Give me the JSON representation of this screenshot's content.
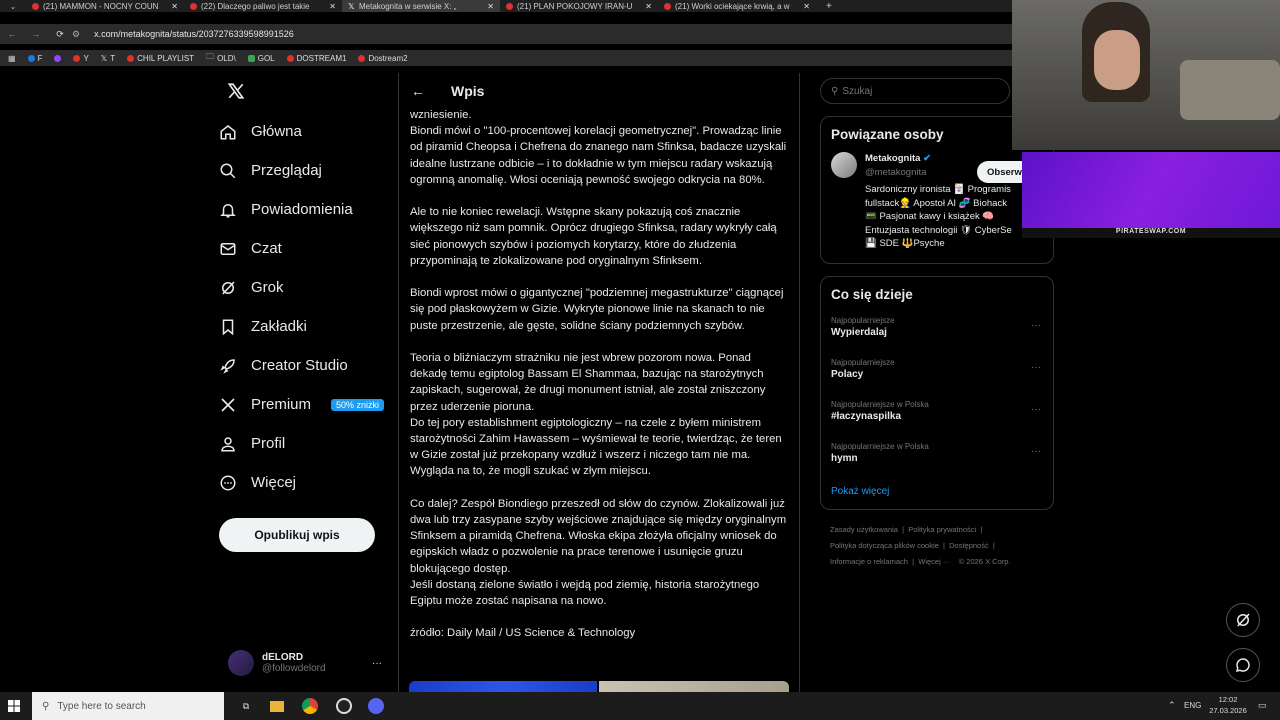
{
  "browser": {
    "tabs": [
      {
        "label": "(21) MAMMON - NOCNY COUN",
        "active": false
      },
      {
        "label": "(22) Dlaczego paliwo jest takie",
        "active": false
      },
      {
        "label": "Metakognita w serwisie X: „",
        "active": true
      },
      {
        "label": "(21) PLAN POKOJOWY IRAN-U",
        "active": false
      },
      {
        "label": "(21) Worki ociekające krwią, a w",
        "active": false
      }
    ],
    "new_tab": "+",
    "url": "x.com/metakognita/status/2037276339598991526",
    "bookmarks": [
      "F",
      "Y",
      "T",
      "CHIL PLAYLIST",
      "OLD\\",
      "GOL",
      "DOSTREAM1",
      "Dostream2"
    ]
  },
  "sidebar": {
    "items": [
      {
        "label": "Główna",
        "icon": "home-icon"
      },
      {
        "label": "Przeglądaj",
        "icon": "search-icon"
      },
      {
        "label": "Powiadomienia",
        "icon": "bell-icon"
      },
      {
        "label": "Czat",
        "icon": "mail-icon"
      },
      {
        "label": "Grok",
        "icon": "grok-icon"
      },
      {
        "label": "Zakładki",
        "icon": "bookmark-icon"
      },
      {
        "label": "Creator Studio",
        "icon": "rocket-icon"
      },
      {
        "label": "Premium",
        "icon": "x-logo-icon"
      },
      {
        "label": "Profil",
        "icon": "person-icon"
      },
      {
        "label": "Więcej",
        "icon": "more-circle-icon"
      }
    ],
    "premium_badge": "50% zniżki",
    "publish_label": "Opublikuj wpis",
    "account": {
      "name": "dELORD",
      "handle": "@followdelord",
      "menu": "···"
    }
  },
  "main": {
    "header": "Wpis",
    "post_paragraphs": [
      "wzniesienie.",
      "Biondi mówi o \"100-procentowej korelacji geometrycznej\". Prowadząc linie od piramid Cheopsa i Chefrena do znanego nam Sfinksa, badacze uzyskali idealne lustrzane odbicie – i to dokładnie w tym miejscu radary wskazują ogromną anomalię. Włosi oceniają pewność swojego odkrycia na 80%.",
      "Ale to nie koniec rewelacji. Wstępne skany pokazują coś znacznie większego niż sam pomnik. Oprócz drugiego Sfinksa, radary wykryły całą sieć pionowych szybów i poziomych korytarzy, które do złudzenia przypominają te zlokalizowane pod oryginalnym Sfinksem.",
      "Biondi wprost mówi o gigantycznej \"podziemnej megastrukturze\" ciągnącej się pod płaskowyżem w Gizie. Wykryte pionowe linie na skanach to nie puste przestrzenie, ale gęste, solidne ściany podziemnych szybów.",
      "Teoria o bliźniaczym strażniku nie jest wbrew pozorom nowa. Ponad dekadę temu egiptolog Bassam El Shammaa, bazując na starożytnych zapiskach, sugerował, że drugi monument istniał, ale został zniszczony przez uderzenie pioruna.",
      "Do tej pory establishment egiptologiczny – na czele z byłem ministrem starożytności Zahim Hawassem – wyśmiewał te teorie, twierdząc, że teren w Gizie został już przekopany wzdłuż i wszerz i niczego tam nie ma. Wygląda na to, że mogli szukać w złym miejscu.",
      "Co dalej? Zespół Biondiego przeszedł od słów do czynów. Zlokalizowali już dwa lub trzy zasypane szyby wejściowe znajdujące się między oryginalnym Sfinksem a piramidą Chefrena. Włoska ekipa złożyła oficjalny wniosek do egipskich władz o pozwolenie na prace terenowe i usunięcie gruzu blokującego dostęp.",
      "Jeśli dostaną zielone światło i wejdą pod ziemię, historia starożytnego Egiptu może zostać napisana na nowo.",
      "źródło: Daily Mail / US Science & Technology"
    ]
  },
  "right": {
    "search_placeholder": "Szukaj",
    "people_title": "Powiązane osoby",
    "person": {
      "name": "Metakognita",
      "handle": "@metakognita",
      "follow": "Obserw",
      "bio": [
        "Sardoniczny ironista 🃏 Programis",
        "fullstack👷 Apostoł AI 🧬 Biohack",
        "📟 Pasjonat kawy i książek 🧠",
        "Entuzjasta technologii 🛡 CyberSe",
        "💾 SDE 🔱Psyche"
      ]
    },
    "trends_title": "Co się dzieje",
    "trends": [
      {
        "context": "Najpopularniejsze",
        "name": "Wypierdalaj"
      },
      {
        "context": "Najpopularniejsze",
        "name": "Polacy"
      },
      {
        "context": "Najpopularniejsze w Polska",
        "name": "#łaczynaspilka"
      },
      {
        "context": "Najpopularniejsze w Polska",
        "name": "hymn"
      }
    ],
    "trend_menu": "···",
    "show_more": "Pokaż więcej",
    "footer_links": [
      "Zasady użytkowania",
      "Polityka prywatności",
      "Polityka dotycząca plików cookie",
      "Dostępność",
      "Informacje o reklamach",
      "Więcej ···",
      "© 2026 X Corp."
    ]
  },
  "overlay": {
    "stream_label": "PIRATESWAP.COM"
  },
  "taskbar": {
    "search_placeholder": "Type here to search",
    "lang": "ENG",
    "time": "12:02",
    "date": "27.03.2026"
  },
  "colors": {
    "accent": "#1d9bf0",
    "background": "#000000",
    "border": "#2f3336",
    "muted": "#71767b"
  }
}
